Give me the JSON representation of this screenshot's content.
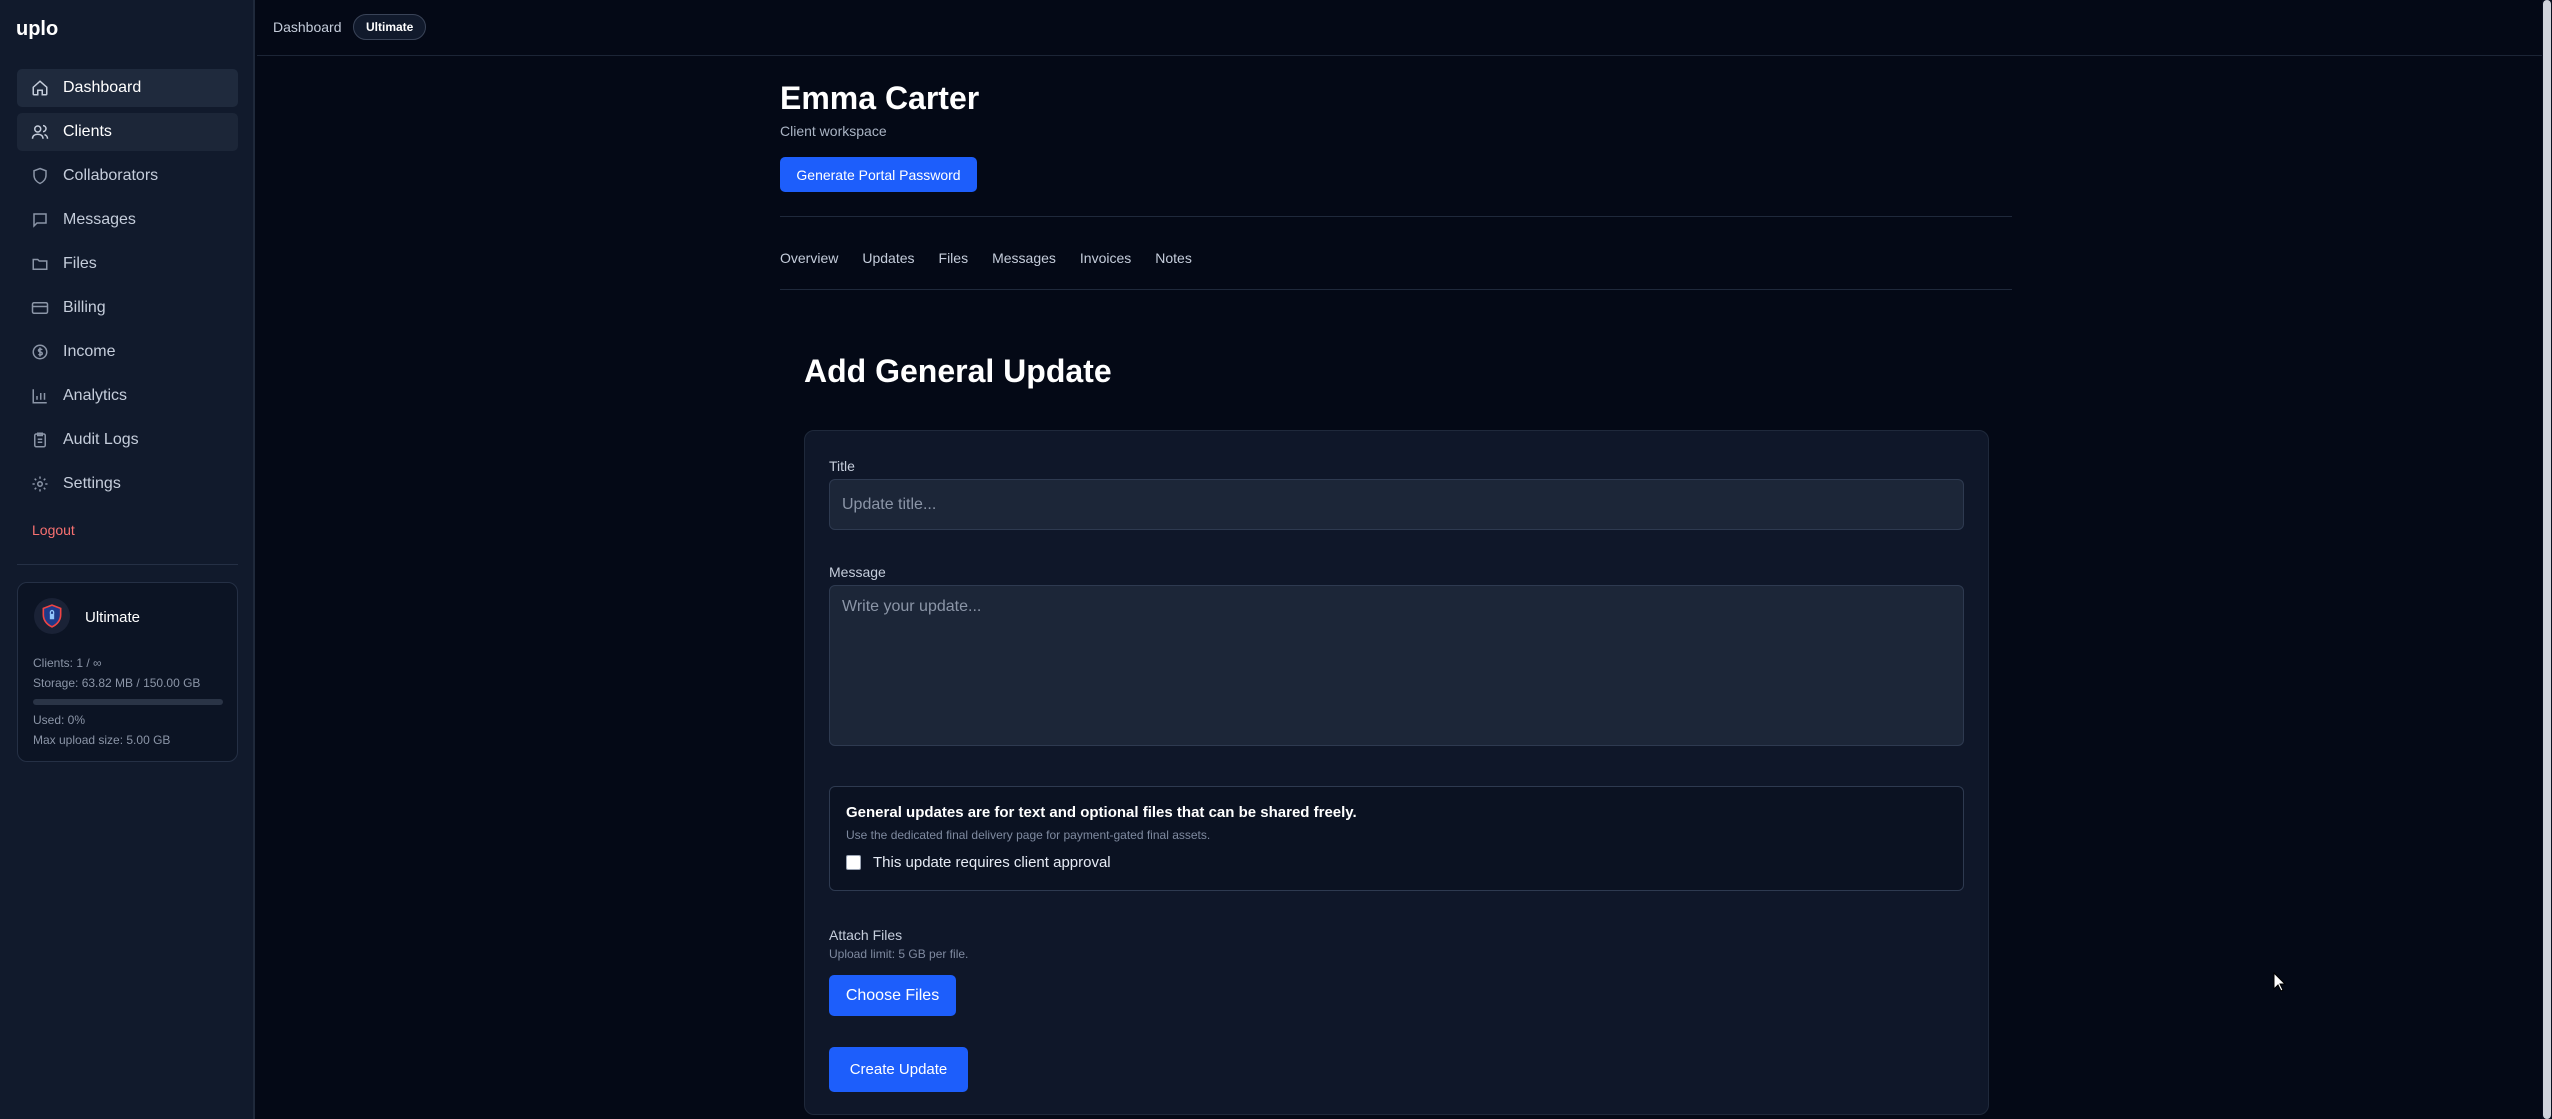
{
  "app": {
    "brand": "uplo"
  },
  "sidebar": {
    "items": [
      {
        "label": "Dashboard",
        "icon": "home-icon"
      },
      {
        "label": "Clients",
        "icon": "users-icon"
      },
      {
        "label": "Collaborators",
        "icon": "shield-icon"
      },
      {
        "label": "Messages",
        "icon": "message-icon"
      },
      {
        "label": "Files",
        "icon": "folder-icon"
      },
      {
        "label": "Billing",
        "icon": "credit-card-icon"
      },
      {
        "label": "Income",
        "icon": "dollar-circle-icon"
      },
      {
        "label": "Analytics",
        "icon": "bar-chart-icon"
      },
      {
        "label": "Audit Logs",
        "icon": "clipboard-icon"
      },
      {
        "label": "Settings",
        "icon": "gear-icon"
      }
    ],
    "logout": "Logout",
    "plan": {
      "name": "Ultimate",
      "clients": "Clients: 1 / ∞",
      "storage": "Storage: 63.82 MB / 150.00 GB",
      "used": "Used: 0%",
      "used_fraction": 0.0,
      "max_upload": "Max upload size: 5.00 GB"
    }
  },
  "topbar": {
    "breadcrumb": "Dashboard",
    "badge": "Ultimate"
  },
  "client": {
    "name": "Emma Carter",
    "subtitle": "Client workspace",
    "generate_button": "Generate Portal Password"
  },
  "tabs": [
    "Overview",
    "Updates",
    "Files",
    "Messages",
    "Invoices",
    "Notes"
  ],
  "form": {
    "heading": "Add General Update",
    "title_label": "Title",
    "title_placeholder": "Update title...",
    "message_label": "Message",
    "message_placeholder": "Write your update...",
    "notice_title": "General updates are for text and optional files that can be shared freely.",
    "notice_sub": "Use the dedicated final delivery page for payment-gated final assets.",
    "approval_label": "This update requires client approval",
    "attach_label": "Attach Files",
    "attach_sub": "Upload limit: 5 GB per file.",
    "choose_button": "Choose Files",
    "create_button": "Create Update"
  },
  "colors": {
    "accent": "#1d5efb",
    "logout": "#f87171",
    "background": "#040916",
    "sidebar": "#111a2c"
  }
}
